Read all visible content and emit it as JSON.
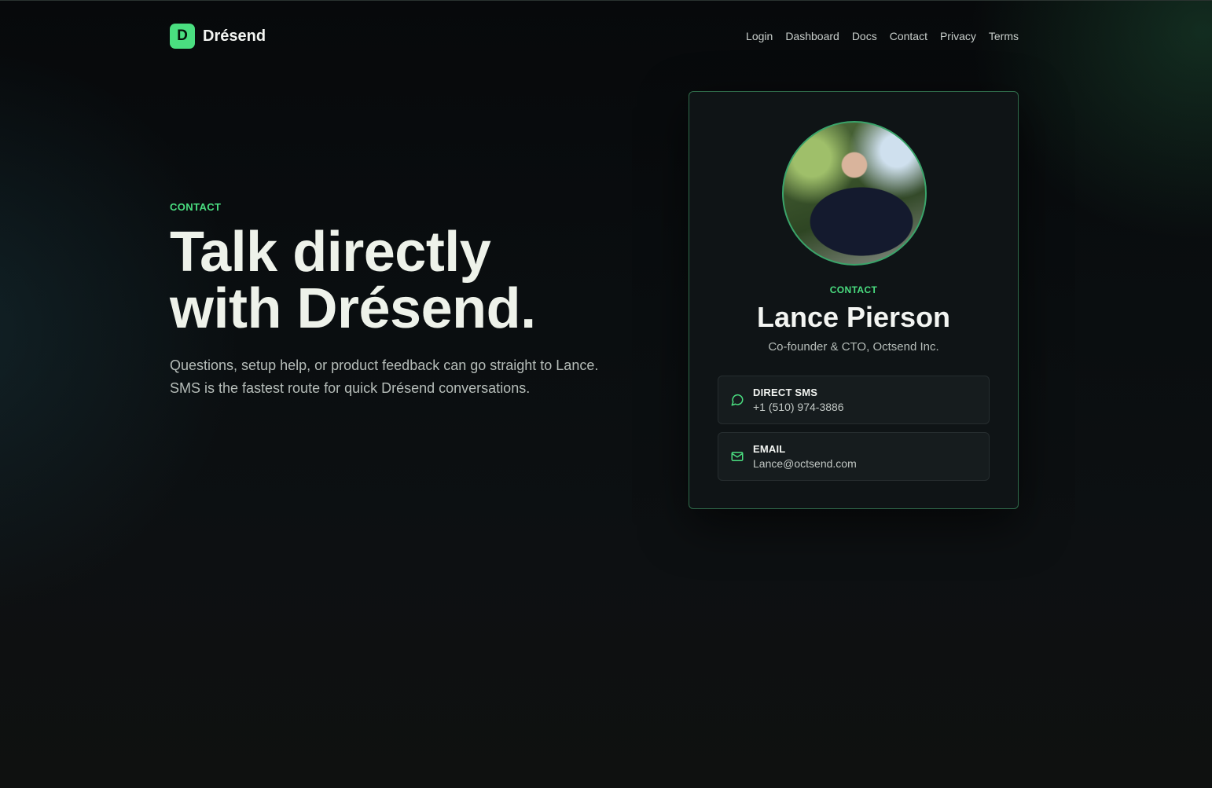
{
  "brand": {
    "mark": "D",
    "name": "Drésend",
    "accent": "#4ade80"
  },
  "nav": [
    "Login",
    "Dashboard",
    "Docs",
    "Contact",
    "Privacy",
    "Terms"
  ],
  "hero": {
    "eyebrow": "CONTACT",
    "headline_line1": "Talk directly",
    "headline_line2": "with Drésend.",
    "lede_line1": "Questions, setup help, or product feedback can go straight to Lance.",
    "lede_line2": "SMS is the fastest route for quick Drésend conversations."
  },
  "card": {
    "eyebrow": "CONTACT",
    "name": "Lance Pierson",
    "role": "Co-founder & CTO, Octsend Inc.",
    "avatar_icon": "profile-photo",
    "sms": {
      "icon": "message-circle-icon",
      "label": "DIRECT SMS",
      "value": "+1 (510) 974-3886"
    },
    "email": {
      "icon": "mail-icon",
      "label": "EMAIL",
      "value": "Lance@octsend.com"
    }
  }
}
